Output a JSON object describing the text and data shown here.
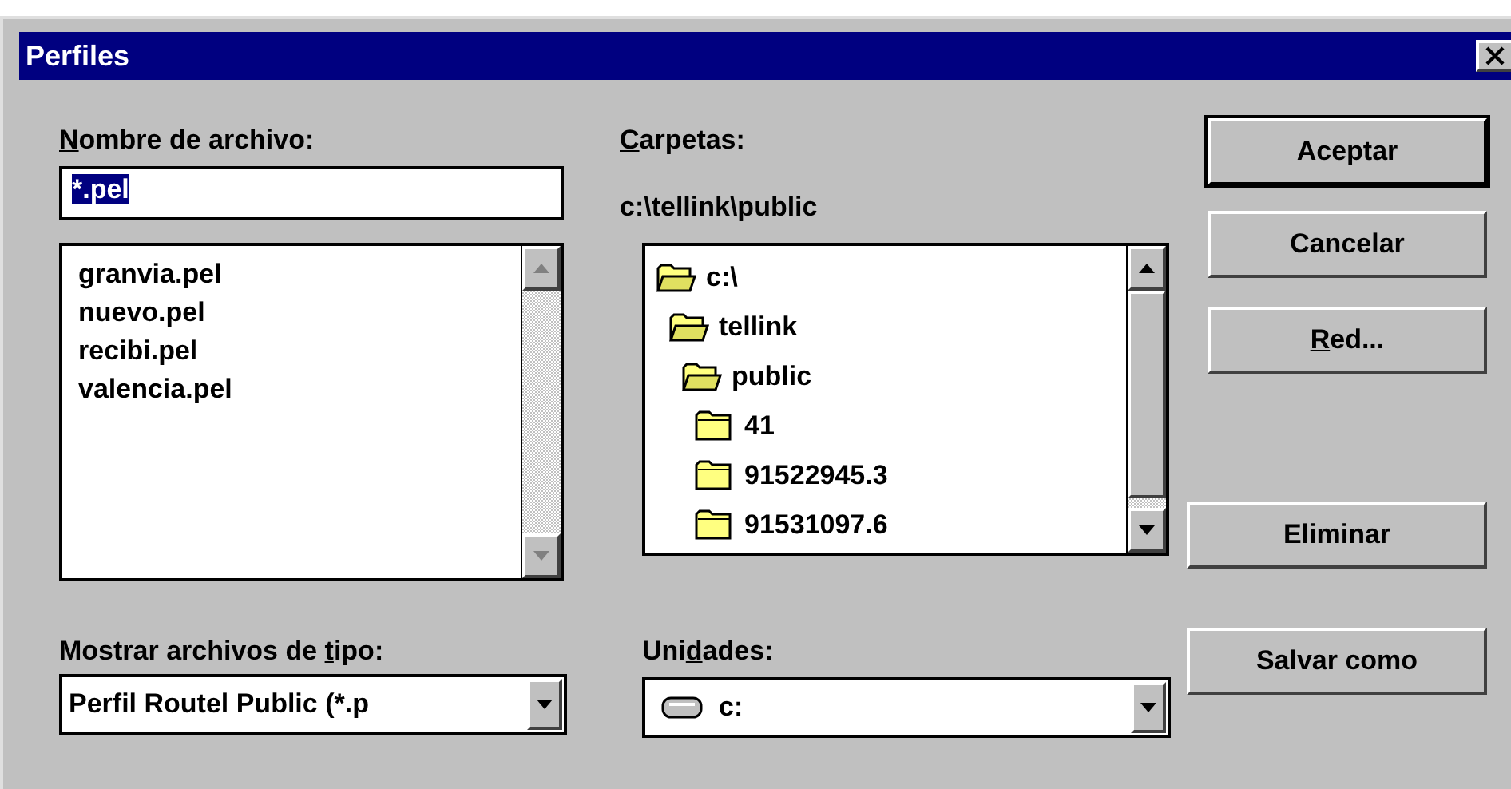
{
  "window": {
    "title": "Perfiles"
  },
  "file_name": {
    "label": {
      "key": "N",
      "after": "ombre de archivo:"
    },
    "value": "*.pel",
    "value_selected": true
  },
  "files": [
    "granvia.pel",
    "nuevo.pel",
    "recibi.pel",
    "valencia.pel"
  ],
  "folders": {
    "label": {
      "key": "C",
      "after": "arpetas:"
    },
    "path": "c:\\tellink\\public",
    "tree": [
      {
        "name": "c:\\",
        "open": true,
        "children": [
          {
            "name": "tellink",
            "open": true,
            "children": [
              {
                "name": "public",
                "open": true,
                "children": [
                  {
                    "name": "41",
                    "open": false
                  },
                  {
                    "name": "91522945.3",
                    "open": false
                  },
                  {
                    "name": "91531097.6",
                    "open": false
                  }
                ]
              }
            ]
          }
        ]
      }
    ]
  },
  "file_type": {
    "label": {
      "before": "Mostrar archivos de ",
      "key": "t",
      "after": "ipo:"
    },
    "value": "Perfil Routel Public (*.p"
  },
  "drives": {
    "label": {
      "before": "Uni",
      "key": "d",
      "after": "ades:"
    },
    "value": "c:"
  },
  "buttons": [
    {
      "label": {
        "before": "Aceptar"
      },
      "default": true
    },
    {
      "label": {
        "before": "Cancelar"
      },
      "default": false
    },
    {
      "label": {
        "key": "R",
        "after": "ed..."
      },
      "default": false
    }
  ],
  "delete_button": {
    "label": "Eliminar"
  },
  "save_as_button": {
    "label": "Salvar como"
  }
}
